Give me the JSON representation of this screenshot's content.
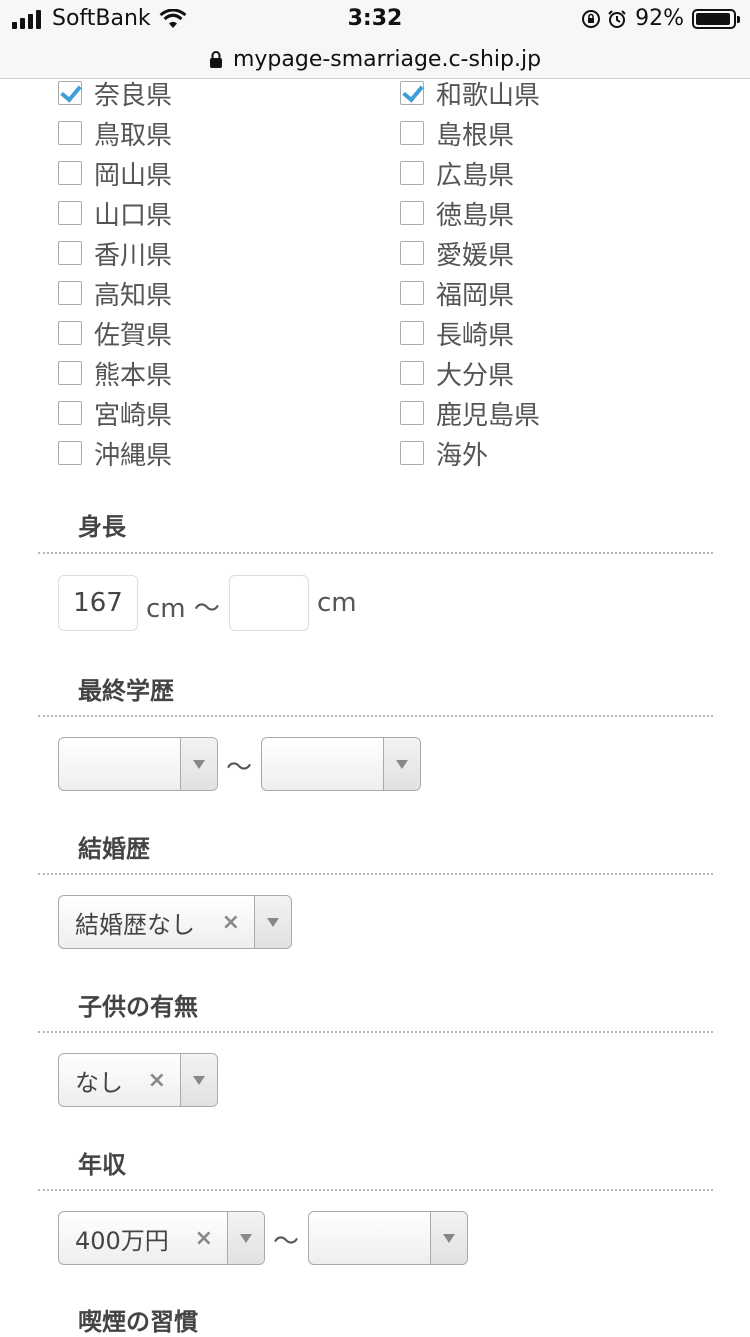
{
  "status_bar": {
    "carrier": "SoftBank",
    "time": "3:32",
    "battery": "92%",
    "icons": [
      "signal-icon",
      "wifi-icon",
      "orientation-lock-icon",
      "alarm-icon",
      "battery-icon"
    ]
  },
  "url_bar": {
    "url": "mypage-smarriage.c-ship.jp",
    "icon": "lock-icon"
  },
  "prefectures": {
    "left": [
      {
        "label": "奈良県",
        "checked": true
      },
      {
        "label": "鳥取県",
        "checked": false
      },
      {
        "label": "岡山県",
        "checked": false
      },
      {
        "label": "山口県",
        "checked": false
      },
      {
        "label": "香川県",
        "checked": false
      },
      {
        "label": "高知県",
        "checked": false
      },
      {
        "label": "佐賀県",
        "checked": false
      },
      {
        "label": "熊本県",
        "checked": false
      },
      {
        "label": "宮崎県",
        "checked": false
      },
      {
        "label": "沖縄県",
        "checked": false
      }
    ],
    "right": [
      {
        "label": "和歌山県",
        "checked": true
      },
      {
        "label": "島根県",
        "checked": false
      },
      {
        "label": "広島県",
        "checked": false
      },
      {
        "label": "徳島県",
        "checked": false
      },
      {
        "label": "愛媛県",
        "checked": false
      },
      {
        "label": "福岡県",
        "checked": false
      },
      {
        "label": "長崎県",
        "checked": false
      },
      {
        "label": "大分県",
        "checked": false
      },
      {
        "label": "鹿児島県",
        "checked": false
      },
      {
        "label": "海外",
        "checked": false
      }
    ]
  },
  "height": {
    "title": "身長",
    "min_value": "167",
    "max_value": "",
    "unit": "cm",
    "separator": "〜"
  },
  "education": {
    "title": "最終学歴",
    "min_value": "",
    "max_value": "",
    "separator": "〜"
  },
  "marriage_history": {
    "title": "結婚歴",
    "value": "結婚歴なし",
    "clear": "×"
  },
  "children": {
    "title": "子供の有無",
    "value": "なし",
    "clear": "×"
  },
  "income": {
    "title": "年収",
    "min_value": "400万円",
    "max_value": "",
    "clear": "×",
    "separator": "〜"
  },
  "smoking": {
    "title": "喫煙の習慣"
  },
  "colors": {
    "accent_check": "#3f9ed8",
    "divider": "#b5b5b5"
  }
}
